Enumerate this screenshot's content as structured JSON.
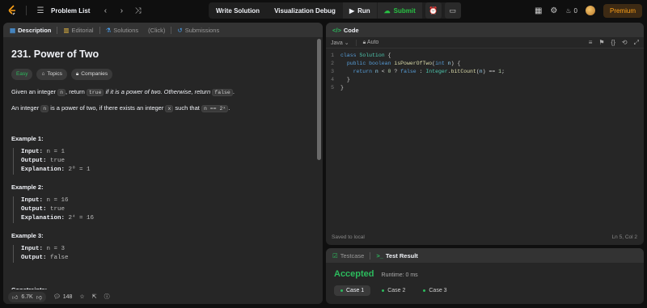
{
  "topbar": {
    "problem_list": "Problem List",
    "write_solution": "Write Solution",
    "visualization_debug": "Visualization Debug",
    "run": "Run",
    "submit": "Submit",
    "fire_count": "0",
    "premium": "Premium"
  },
  "left_tabs": {
    "description": "Description",
    "editorial": "Editorial",
    "solutions": "Solutions",
    "click": "(Click)",
    "submissions": "Submissions"
  },
  "problem": {
    "title": "231. Power of Two",
    "tags": {
      "easy": "Easy",
      "topics": "Topics",
      "companies": "Companies"
    },
    "p1_a": "Given an integer ",
    "p1_n": "n",
    "p1_b": ", return ",
    "p1_true": "true",
    "p1_c": " if it is a power of two. Otherwise, return ",
    "p1_false": "false",
    "p1_d": ".",
    "p2_a": "An integer ",
    "p2_n": "n",
    "p2_b": " is a power of two, if there exists an integer ",
    "p2_x": "x",
    "p2_c": " such that ",
    "p2_eq": "n == 2ˣ",
    "p2_d": ".",
    "examples": [
      {
        "title": "Example 1:",
        "input": "n = 1",
        "output": "true",
        "explanation": "2⁰ = 1"
      },
      {
        "title": "Example 2:",
        "input": "n = 16",
        "output": "true",
        "explanation": "2⁴ = 16"
      },
      {
        "title": "Example 3:",
        "input": "n = 3",
        "output": "false"
      }
    ],
    "labels": {
      "input": "Input:",
      "output": "Output:",
      "explanation": "Explanation:"
    },
    "constraints": "Constraints:"
  },
  "left_footer": {
    "likes": "6.7K",
    "comments": "148"
  },
  "code_panel": {
    "tab": "Code",
    "language": "Java",
    "mode": "Auto",
    "saved": "Saved to local",
    "position": "Ln 5, Col 2",
    "line_numbers": [
      "1",
      "2",
      "3",
      "4",
      "5"
    ]
  },
  "result_panel": {
    "tab_testcase": "Testcase",
    "tab_result": "Test Result",
    "status": "Accepted",
    "runtime": "Runtime: 0 ms",
    "cases": [
      "Case 1",
      "Case 2",
      "Case 3"
    ]
  },
  "colors": {
    "accent": "#ffa116",
    "accepted": "#2cbb5d",
    "panel": "#262626"
  }
}
